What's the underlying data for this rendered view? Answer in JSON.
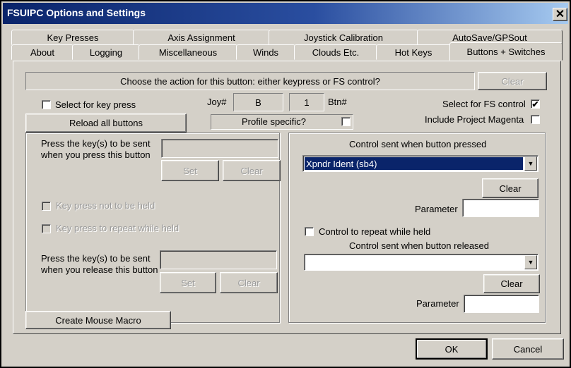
{
  "window": {
    "title": "FSUIPC Options and Settings",
    "close_glyph": "✕"
  },
  "tabs_row1": [
    "Key Presses",
    "Axis Assignment",
    "Joystick Calibration",
    "AutoSave/GPSout"
  ],
  "tabs_row2": [
    "About",
    "Logging",
    "Miscellaneous",
    "Winds",
    "Clouds Etc.",
    "Hot Keys",
    "Buttons + Switches"
  ],
  "prompt": {
    "text": "Choose the action for this button: either keypress or FS control?",
    "clear_label": "Clear"
  },
  "select_key_press": {
    "label": "Select for key press",
    "checked": false
  },
  "reload_button": "Reload all buttons",
  "joy": {
    "joy_label": "Joy#",
    "joy_value": "B",
    "btn_value": "1",
    "btn_label": "Btn#"
  },
  "profile_specific": {
    "label": "Profile specific?",
    "checked": false
  },
  "select_fs_control": {
    "label": "Select for FS control",
    "checked": true,
    "check_glyph": "✔"
  },
  "include_magenta": {
    "label": "Include Project Magenta",
    "checked": false
  },
  "keypress_panel": {
    "press_label": "Press the key(s) to be sent when you press this button",
    "press_value": "",
    "set_label": "Set",
    "clear_label": "Clear",
    "not_held_label": "Key press not to be held",
    "repeat_label": "Key press to repeat while held",
    "release_label": "Press the key(s) to be sent when you release this button",
    "release_value": "",
    "set2_label": "Set",
    "clear2_label": "Clear"
  },
  "mouse_macro_button": "Create Mouse Macro",
  "control_panel": {
    "pressed_title": "Control sent when button pressed",
    "pressed_value": "Xpndr Ident (sb4)",
    "clear_label": "Clear",
    "parameter_label": "Parameter",
    "parameter_value": "",
    "repeat_label": "Control to repeat while held",
    "released_title": "Control sent when button released",
    "released_value": "",
    "clear2_label": "Clear",
    "parameter2_label": "Parameter",
    "parameter2_value": "",
    "dropdown_glyph": "▼"
  },
  "footer": {
    "ok_label": "OK",
    "cancel_label": "Cancel"
  }
}
